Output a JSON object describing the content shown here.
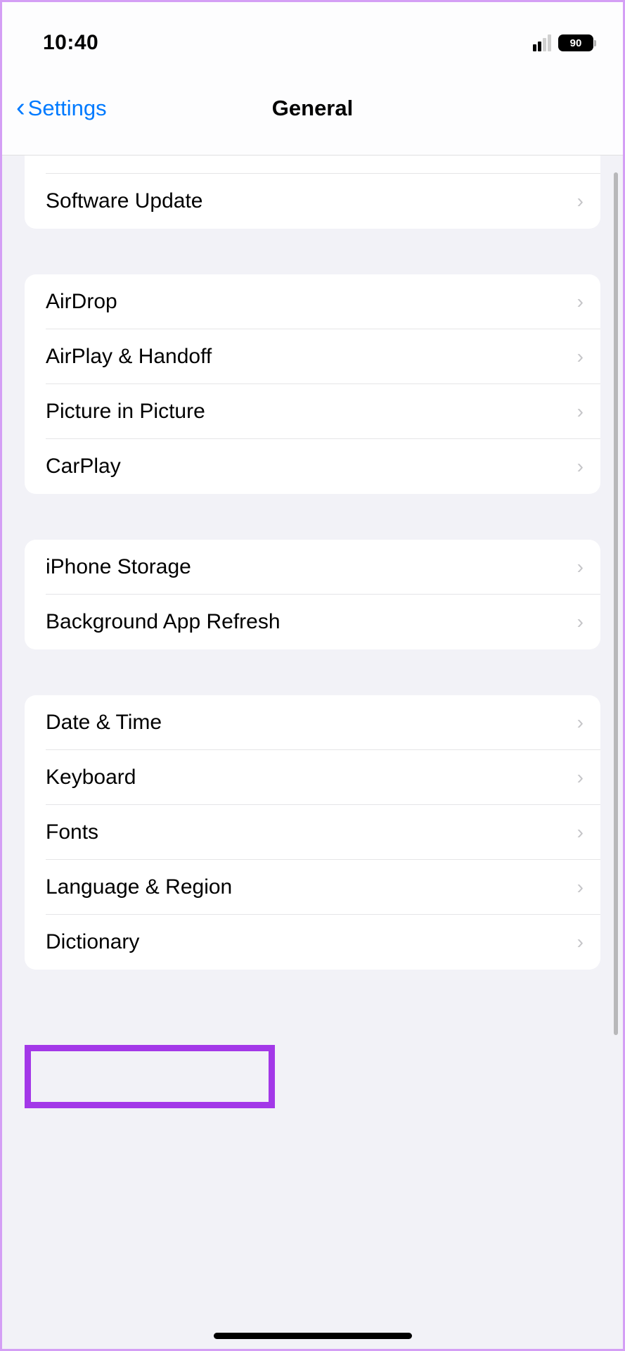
{
  "status": {
    "time": "10:40",
    "battery": "90"
  },
  "nav": {
    "back_label": "Settings",
    "title": "General"
  },
  "groups": [
    {
      "items": [
        {
          "label": "Software Update",
          "name": "row-software-update"
        }
      ]
    },
    {
      "items": [
        {
          "label": "AirDrop",
          "name": "row-airdrop"
        },
        {
          "label": "AirPlay & Handoff",
          "name": "row-airplay-handoff"
        },
        {
          "label": "Picture in Picture",
          "name": "row-picture-in-picture"
        },
        {
          "label": "CarPlay",
          "name": "row-carplay"
        }
      ]
    },
    {
      "items": [
        {
          "label": "iPhone Storage",
          "name": "row-iphone-storage"
        },
        {
          "label": "Background App Refresh",
          "name": "row-background-app-refresh"
        }
      ]
    },
    {
      "items": [
        {
          "label": "Date & Time",
          "name": "row-date-time"
        },
        {
          "label": "Keyboard",
          "name": "row-keyboard"
        },
        {
          "label": "Fonts",
          "name": "row-fonts"
        },
        {
          "label": "Language & Region",
          "name": "row-language-region"
        },
        {
          "label": "Dictionary",
          "name": "row-dictionary"
        }
      ]
    }
  ]
}
